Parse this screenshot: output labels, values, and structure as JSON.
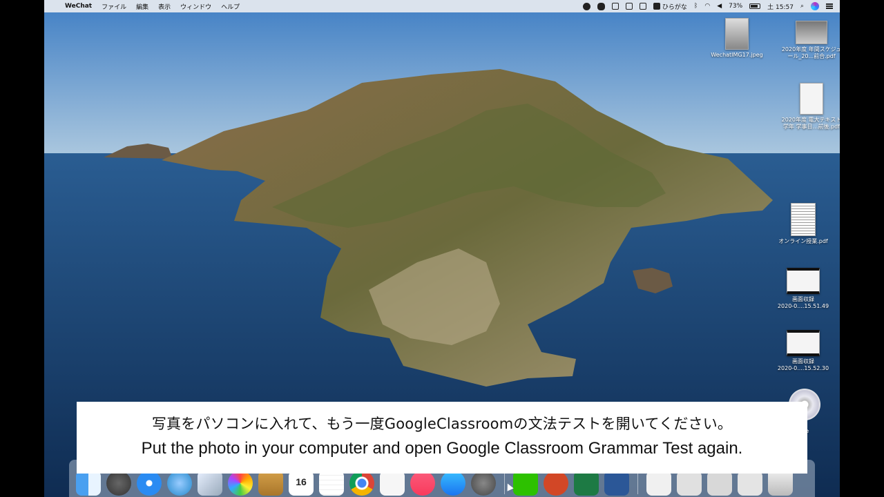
{
  "menubar": {
    "apple": "",
    "app_name": "WeChat",
    "menus": [
      "ファイル",
      "編集",
      "表示",
      "ウィンドウ",
      "ヘルプ"
    ],
    "input_method": "ひらがな",
    "battery": "73%",
    "clock": "土 15:57"
  },
  "desktop": {
    "items": [
      {
        "label": "WechatIMG17.jpeg"
      },
      {
        "label": "2020年度 年間スケジュール_20...前合.pdf"
      },
      {
        "label": "2020年度 電大テキスト 学年 学事日…前後.pdf"
      },
      {
        "label": "オンライン授業.pdf"
      },
      {
        "label": "画面収録\n2020-0....15.51.49"
      },
      {
        "label": "画面収録\n2020-0....15.52.30"
      }
    ],
    "cd_label": "le"
  },
  "subtitle": {
    "japanese": "写真をパソコンに入れて、もう一度GoogleClassroomの文法テストを開いてください。",
    "english": "Put the photo in your computer and open Google Classroom Grammar Test again."
  },
  "dock": {
    "calendar_day": "16",
    "icons": [
      "finder-icon",
      "launchpad-icon",
      "safari-icon",
      "messages-icon",
      "photos-app-icon",
      "photos-icon",
      "notes-icon",
      "calendar-icon",
      "reminders-icon",
      "chrome-icon",
      "textedit-icon",
      "music-icon",
      "app-store-icon",
      "system-preferences-icon",
      "wechat-icon",
      "powerpoint-icon",
      "excel-icon",
      "word-icon",
      "document-icon",
      "screenshot-icon",
      "screenshot-icon",
      "screenshot-icon",
      "trash-icon"
    ]
  },
  "colors": {
    "sky": "#5a8fc8",
    "sea": "#1d3f6e",
    "island": "#7a6a4a",
    "menubar": "#e8ecf0"
  }
}
